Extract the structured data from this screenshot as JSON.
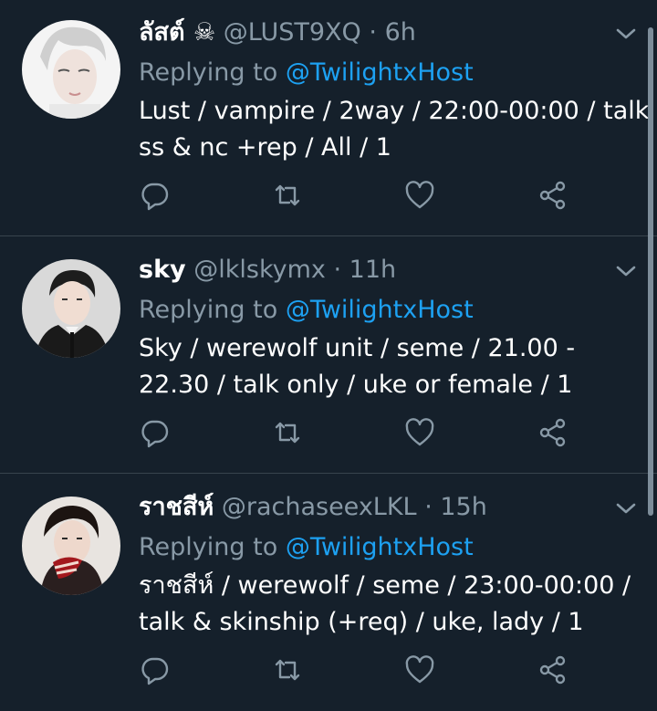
{
  "colors": {
    "background": "#15202b",
    "divider": "#38444d",
    "muted": "#8899a6",
    "link": "#1da1f2",
    "text": "#ffffff"
  },
  "icons": {
    "reply": "speech-bubble-icon",
    "retweet": "retweet-arrows-icon",
    "like": "heart-icon",
    "share": "share-nodes-icon",
    "menu": "chevron-down-icon"
  },
  "tweets": [
    {
      "display_name": "ลัสต์ ☠",
      "handle": "@LUST9XQ",
      "dot": "·",
      "time": "6h",
      "replying_prefix": "Replying to",
      "replying_to": "@TwilightxHost",
      "body_lines": [
        "Lust / vampire / 2way / 22:00-00:00 / talk",
        "ss & nc +rep / All / 1"
      ]
    },
    {
      "display_name": "sky",
      "handle": "@lklskymx",
      "dot": "·",
      "time": "11h",
      "replying_prefix": "Replying to",
      "replying_to": "@TwilightxHost",
      "body_lines": [
        "Sky / werewolf unit / seme / 21.00 -",
        "22.30 / talk only / uke or female / 1"
      ]
    },
    {
      "display_name": "ราชสีห์",
      "handle": "@rachaseexLKL",
      "dot": "·",
      "time": "15h",
      "replying_prefix": "Replying to",
      "replying_to": "@TwilightxHost",
      "body_lines": [
        "ราชสีห์ / werewolf / seme / 23:00-00:00 /",
        "talk & skinship (+req) / uke, lady / 1"
      ]
    }
  ]
}
